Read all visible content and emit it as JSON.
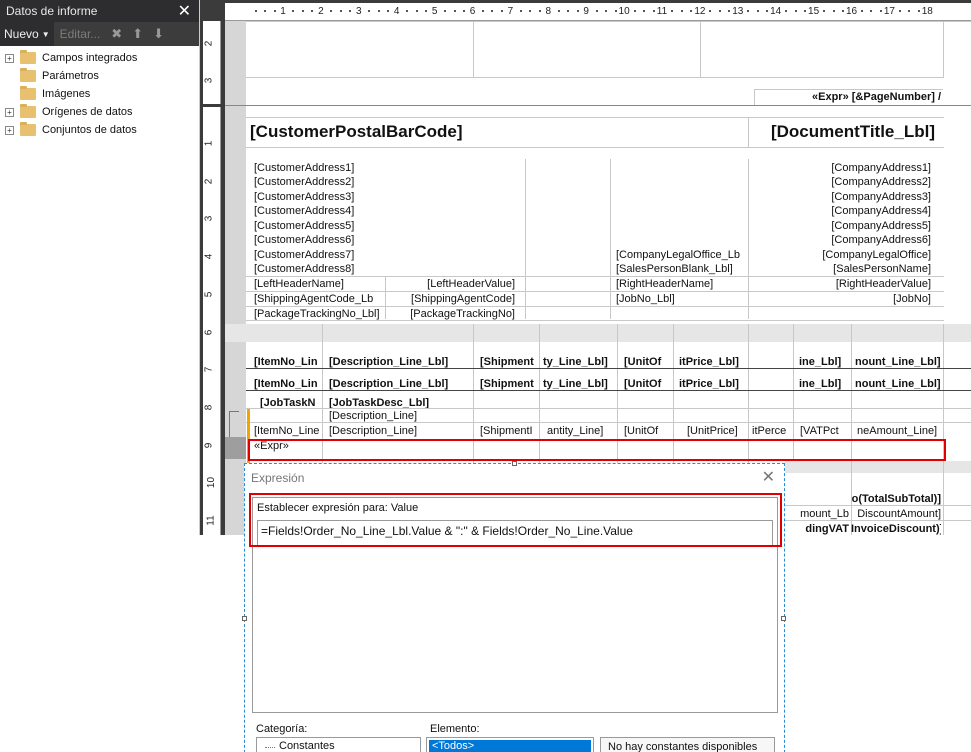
{
  "left_panel": {
    "title": "Datos de informe",
    "close_glyph": "✕",
    "toolbar": {
      "new_label": "Nuevo",
      "edit_label": "Editar...",
      "delete_icon": "delete-icon",
      "up_icon": "move-up-icon",
      "down_icon": "move-down-icon"
    },
    "tree": [
      {
        "label": "Campos integrados",
        "expandable": true
      },
      {
        "label": "Parámetros",
        "expandable": false
      },
      {
        "label": "Imágenes",
        "expandable": false
      },
      {
        "label": "Orígenes de datos",
        "expandable": true
      },
      {
        "label": "Conjuntos de datos",
        "expandable": true
      }
    ]
  },
  "ruler": {
    "horizontal": [
      "1",
      "2",
      "3",
      "4",
      "5",
      "6",
      "7",
      "8",
      "9",
      "10",
      "11",
      "12",
      "13",
      "14",
      "15",
      "16",
      "17",
      "18"
    ],
    "vertical_top": [
      "2",
      "3"
    ],
    "vertical_body": [
      "1",
      "2",
      "3",
      "4",
      "5",
      "6",
      "7",
      "8",
      "9",
      "10",
      "11"
    ]
  },
  "report": {
    "page_number_expr": "«Expr» [&PageNumber] /",
    "customer_postal_barcode": "[CustomerPostalBarCode]",
    "document_title": "[DocumentTitle_Lbl]",
    "customer_addresses": [
      "[CustomerAddress1]",
      "[CustomerAddress2]",
      "[CustomerAddress3]",
      "[CustomerAddress4]",
      "[CustomerAddress5]",
      "[CustomerAddress6]",
      "[CustomerAddress7]",
      "[CustomerAddress8]"
    ],
    "company_addresses": [
      "[CompanyAddress1]",
      "[CompanyAddress2]",
      "[CompanyAddress3]",
      "[CompanyAddress4]",
      "[CompanyAddress5]",
      "[CompanyAddress6]"
    ],
    "company_legal_office_lbl": "[CompanyLegalOffice_Lb",
    "company_legal_office": "[CompanyLegalOffice]",
    "salesperson_blank_lbl": "[SalesPersonBlank_Lbl]",
    "salesperson_name": "[SalesPersonName]",
    "left_header_name": "[LeftHeaderName]",
    "left_header_value": "[LeftHeaderValue]",
    "right_header_name": "[RightHeaderName]",
    "right_header_value": "[RightHeaderValue]",
    "shipping_agent_code_lbl": "[ShippingAgentCode_Lb",
    "shipping_agent_code": "[ShippingAgentCode]",
    "job_no_lbl": "[JobNo_Lbl]",
    "job_no": "[JobNo]",
    "package_tracking_no_lbl": "[PackageTrackingNo_Lbl]",
    "package_tracking_no": "[PackageTrackingNo]",
    "header_row": [
      "[ItemNo_Lin",
      "[Description_Line_Lbl]",
      "[Shipment",
      "ty_Line_Lbl]",
      "[UnitOf",
      "itPrice_Lbl]",
      "",
      "ine_Lbl]",
      "nount_Line_Lbl]"
    ],
    "job_task_no": "[JobTaskN",
    "job_task_desc_lbl": "[JobTaskDesc_Lbl]",
    "description_line": "[Description_Line]",
    "detail_row": [
      "[ItemNo_Line",
      "[Description_Line]",
      "[ShipmentI",
      "antity_Line]",
      "[UnitOf",
      "[UnitPrice]",
      "itPerce",
      "[VATPct",
      "neAmount_Line]"
    ],
    "expr_cell": "«Expr»",
    "total_subtotal": "o(TotalSubTotal)]",
    "amount_lb": "mount_Lb",
    "discount_amount": "DiscountAmount]",
    "uding_vat": "dingVAT",
    "invoice_discount": "InvoiceDiscount)]"
  },
  "dialog": {
    "title": "Expresión",
    "close_glyph": "✕",
    "set_expression_label": "Establecer expresión para: Value",
    "expression_value": "=Fields!Order_No_Line_Lbl.Value & \":\" & Fields!Order_No_Line.Value",
    "category_label": "Categoría:",
    "category_selected": "Constantes",
    "element_label": "Elemento:",
    "element_selected": "<Todos>",
    "info_text": "No hay constantes disponibles"
  }
}
